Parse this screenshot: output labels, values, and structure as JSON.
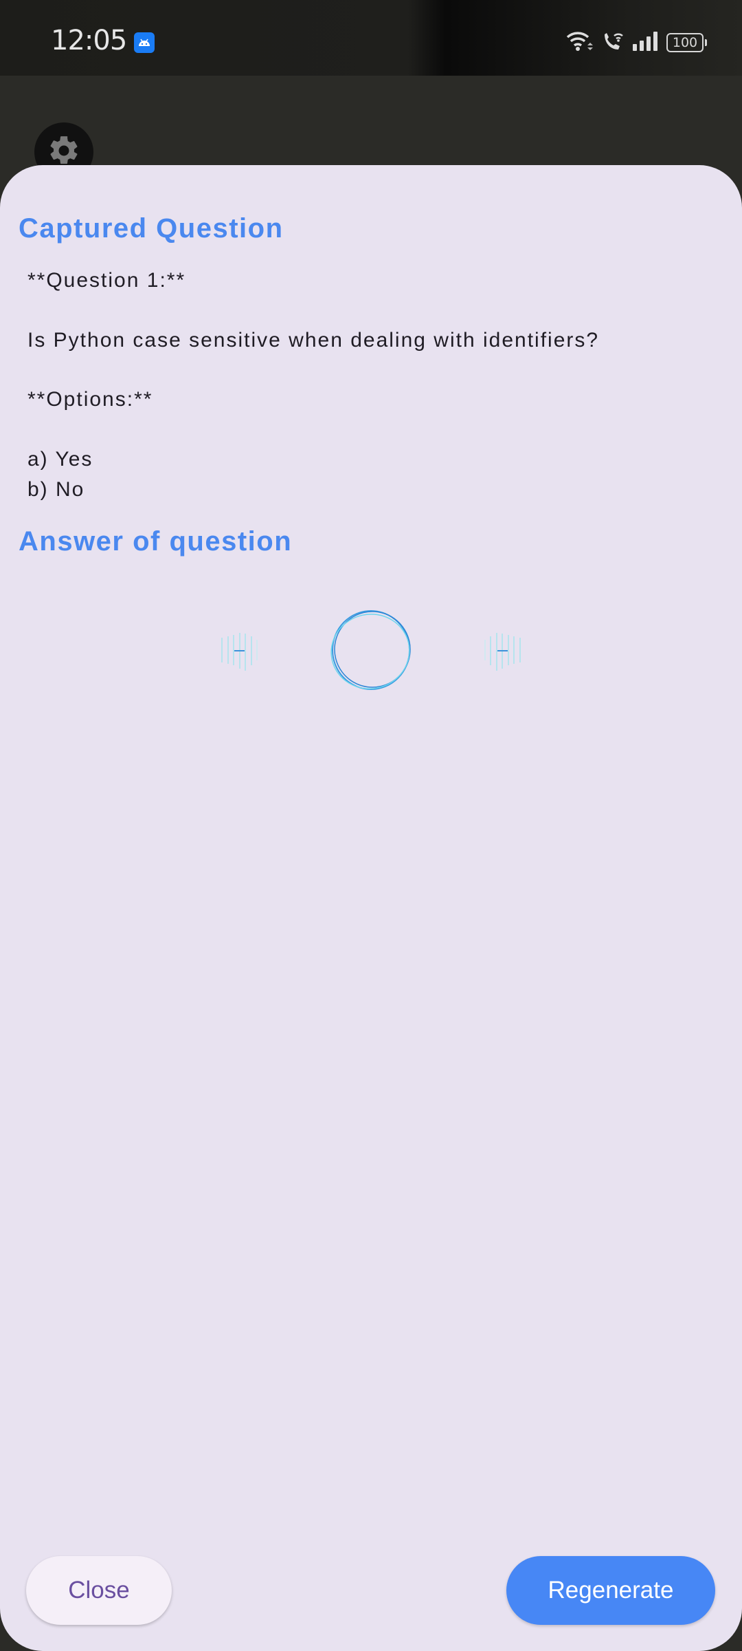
{
  "status_bar": {
    "time": "12:05",
    "notification_icon": "android-icon",
    "icons": [
      "wifi-icon",
      "wifi-calling-icon",
      "signal-icon",
      "battery-icon"
    ],
    "battery_level": "100"
  },
  "background": {
    "fab_icon": "gear-icon"
  },
  "sheet": {
    "captured_heading": "Captured Question",
    "question_label": "**Question 1:**",
    "question_text": "Is Python case sensitive when dealing with identifiers?",
    "options_label": "**Options:**",
    "options": [
      "a) Yes",
      "b) No"
    ],
    "answer_heading": "Answer of question",
    "loading_indicator": "loading-spinner"
  },
  "actions": {
    "close_label": "Close",
    "regenerate_label": "Regenerate"
  },
  "colors": {
    "accent": "#4787f5",
    "heading": "#4a88ef",
    "sheet_background": "#e8e2f0",
    "close_text": "#6a4fa0"
  }
}
